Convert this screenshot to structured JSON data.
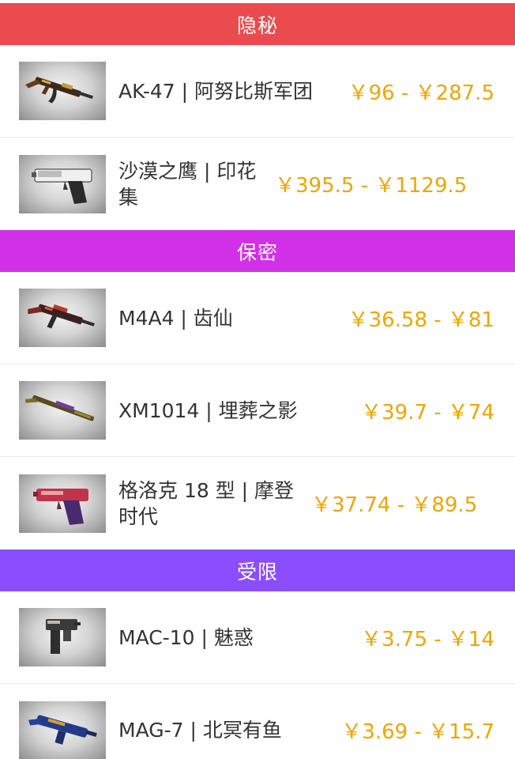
{
  "colors": {
    "covert": "#ea4b4e",
    "classified": "#d230e8",
    "restricted": "#8a4dff",
    "price": "#f0a500",
    "name": "#333333"
  },
  "sections": [
    {
      "title": "隐秘",
      "items": [
        {
          "name": "AK-47 | 阿努比斯军团",
          "price": "￥96 - ￥287.5",
          "icon": "ak47-skin-icon"
        },
        {
          "name": "沙漠之鹰 | 印花集",
          "price": "￥395.5 - ￥1129.5",
          "icon": "desert-eagle-skin-icon"
        }
      ]
    },
    {
      "title": "保密",
      "items": [
        {
          "name": "M4A4 | 齿仙",
          "price": "￥36.58 - ￥81",
          "icon": "m4a4-skin-icon"
        },
        {
          "name": "XM1014 | 埋葬之影",
          "price": "￥39.7 - ￥74",
          "icon": "xm1014-skin-icon"
        },
        {
          "name": "格洛克 18 型 | 摩登时代",
          "price": "￥37.74 - ￥89.5",
          "icon": "glock-18-skin-icon"
        }
      ]
    },
    {
      "title": "受限",
      "items": [
        {
          "name": "MAC-10 | 魅惑",
          "price": "￥3.75 - ￥14",
          "icon": "mac-10-skin-icon"
        },
        {
          "name": "MAG-7 | 北冥有鱼",
          "price": "￥3.69 - ￥15.7",
          "icon": "mag-7-skin-icon"
        }
      ]
    }
  ]
}
